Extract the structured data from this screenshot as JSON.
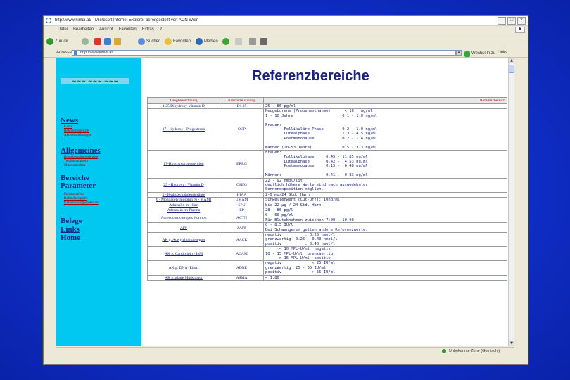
{
  "window": {
    "title": "http://www.kimdi.at/ - Microsoft Internet Explorer bereitgestellt von AON Wien"
  },
  "menu": [
    "Datei",
    "Bearbeiten",
    "Ansicht",
    "Favoriten",
    "Extras",
    "?"
  ],
  "toolbar": {
    "back": "Zurück",
    "search": "Suchen",
    "favorites": "Favoriten",
    "media": "Medien"
  },
  "address": {
    "label": "Adresse",
    "url": "http://www.kimdi.at/",
    "go": "Wechseln zu",
    "links": "Links"
  },
  "page": {
    "title": "Referenzbereiche"
  },
  "sidebar": {
    "sections": [
      {
        "label": "News",
        "items": [
          "Kurse",
          "Referenzbereiche",
          "Aktiveinsichtungen"
        ]
      },
      {
        "label": "Allgemeines",
        "items": [
          "Ringversuchsergebnisse",
          "Telefonnummern",
          "Mitarbeiterliste"
        ]
      },
      {
        "label": "Bereiche Parameter",
        "items": [
          "Parameterliste",
          "Befundbeispiele",
          "Untersuchungsspektrum"
        ]
      },
      {
        "label": "Belege",
        "items": []
      },
      {
        "label": "Links",
        "items": []
      },
      {
        "label": "Home",
        "items": []
      }
    ]
  },
  "table": {
    "headers": [
      "Langbezeichnung",
      "Kurzbezeichnung",
      "Referenzbereich"
    ],
    "rows": [
      {
        "long": "1.25 Dihydroxy-Vitamin D",
        "short": "D1.25",
        "ref": "25 - 86 pg/ml"
      },
      {
        "long": "17 - Hydroxy - Progesteron",
        "short": "OHP",
        "ref": "Neugeborene (Probenentnahme)      < 10   ng/ml\n1 - 10 Jahre                     0.1 - 1.0 ng/ml\n\nFrauen:\n        Follikuläre Phase        0.2 - 1.0 ng/ml\n        Lutealphase              1.3 - 4.5 ng/ml\n        Postmenopause            0.2 - 1.4 ng/ml\n\nMänner (20-53 Jahre)             0.5 - 3.3 ng/ml"
      },
      {
        "long": "17-Hydroxyprogesterolon",
        "short": "ERRG",
        "ref": "Frauen:\n        Follikelphase     0.45 - 11.85 ng/ml\n        Lutealphase       0.42 -  4.53 ng/ml\n        Postmenopause     0.15 -  0.48 ng/ml\n\nMänner:                   0.41 -  0.83 ng/ml"
      },
      {
        "long": "25 - Hydroxy - Vitamin D",
        "short": "OHD3",
        "ref": "22 - 92 nmol/lit\ndeutlich höhere Werte sind nach ausgedehnter\nSonnenexposition möglich."
      },
      {
        "long": "5 - Hydroxyindolessigsäure",
        "short": "HIAA",
        "ref": "2-9 mg/24 Std. Harn"
      },
      {
        "long": "6 - Monoacetylmorphin (6 - MAM)",
        "short": "UMAM",
        "ref": "Schwellenwert (Cut-Off): 10ng/ml"
      },
      {
        "long": "Adrenalin im Harn",
        "short": "SPU",
        "ref": "bis 22 µg / 24 Std. Harn"
      },
      {
        "long": "Adrenalin im Plasma",
        "short": "EP",
        "ref": "28 - 86 pg/l"
      },
      {
        "long": "Adrenocorticotropes Hormon",
        "short": "ACTN",
        "ref": "0 - 60 pg/ml\nFür Blutabnahmen zwischen 7:00 - 10:00"
      },
      {
        "long": "AFP",
        "short": "SAFP",
        "ref": "0 - 8.5 IU/l\nBei Schwangeren gelten andere Referenzwerte."
      },
      {
        "long": "AK g. Acetylcholinrezeptor",
        "short": "AACR",
        "ref": "negativ          : 0.25 nmol/l\ngrenzwertig  0.25 - 0.40 nmol/l\npositiv          : 0.40 nmol/l"
      },
      {
        "long": "AK g. Cardiolipin - IgM",
        "short": "ACAM",
        "ref": "      < 10 MPL-U/ml  negativ\n10 - 15 MPL-U/ml  grenzwertig\n      > 15 MPL-U/ml  positiv"
      },
      {
        "long": "AK g. DNA (Elisa)",
        "short": "ADNE",
        "ref": "negativ             < 25 IU/ml\ngrenzwertig  25 - 55 IU/ml\npositiv             > 55 IU/ml"
      },
      {
        "long": "AK g. glatte Muskulatur",
        "short": "ASMA",
        "ref": "< 1:80"
      }
    ]
  },
  "status": {
    "zone": "Unbekannte Zone (Gemischt)"
  }
}
